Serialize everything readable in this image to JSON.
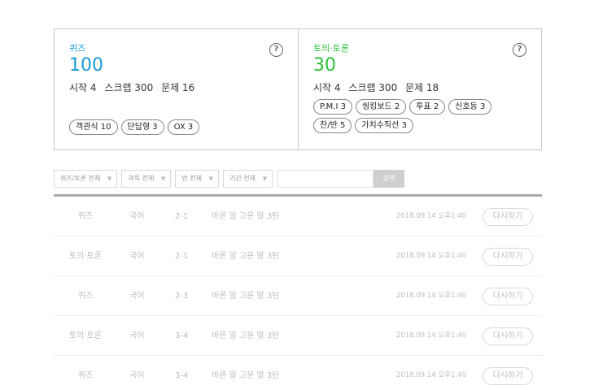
{
  "summary": {
    "quiz": {
      "label": "퀴즈",
      "count": "100",
      "stats": [
        "시작 4",
        "스크랩 300",
        "문제 16"
      ],
      "tags": [
        "객관식 10",
        "단답형 3",
        "OX 3"
      ],
      "help_icon": "question-mark",
      "accent": "#1a9ad6"
    },
    "debate": {
      "label": "토의·토론",
      "count": "30",
      "stats": [
        "시작 4",
        "스크랩 300",
        "문제 18"
      ],
      "tags": [
        "P.M.I 3",
        "씽킹보드 2",
        "투표 2",
        "신호등 3",
        "찬/반 5",
        "가치수직선 3"
      ],
      "help_icon": "question-mark",
      "accent": "#2bbf3a"
    }
  },
  "filters": {
    "type": "퀴즈/토론 전체",
    "subject": "과목 전체",
    "class": "반 전체",
    "period": "기간 전체",
    "search_button": "검색",
    "caret_icon": "chevron-down"
  },
  "rows": [
    {
      "type": "퀴즈",
      "subject": "국어",
      "class": "2-1",
      "title": "바른 말 고운 말 3탄",
      "date": "2018.09.14  오후1:40",
      "action": "다시하기"
    },
    {
      "type": "토의·토론",
      "subject": "국어",
      "class": "2-1",
      "title": "바른 말 고운 말 3탄",
      "date": "2018.09.14  오후1:40",
      "action": "다시하기"
    },
    {
      "type": "퀴즈",
      "subject": "국어",
      "class": "2-3",
      "title": "바른 말 고운 말 3탄",
      "date": "2018.09.14  오후1:40",
      "action": "다시하기"
    },
    {
      "type": "토의·토론",
      "subject": "국어",
      "class": "3-4",
      "title": "바른 말 고운 말 3탄",
      "date": "2018.09.14  오후1:40",
      "action": "다시하기"
    },
    {
      "type": "퀴즈",
      "subject": "국어",
      "class": "3-4",
      "title": "바른 말 고운 말 3탄",
      "date": "2018.09.14  오후1:40",
      "action": "다시하기"
    }
  ]
}
